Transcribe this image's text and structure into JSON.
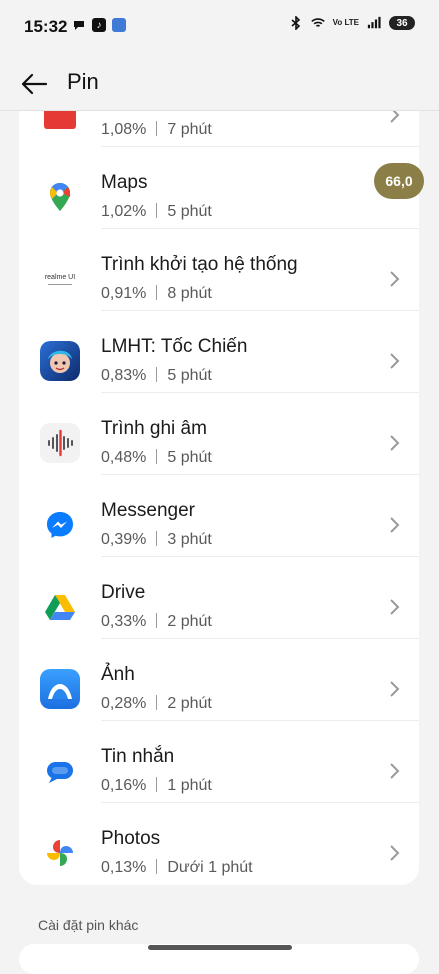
{
  "status_bar": {
    "time": "15:32",
    "network_label": "Vo LTE",
    "battery": "36"
  },
  "header": {
    "title": "Pin"
  },
  "apps": [
    {
      "name": "",
      "percent": "1,08%",
      "time": "7 phút",
      "icon": "red-app-icon"
    },
    {
      "name": "Maps",
      "percent": "1,02%",
      "time": "5 phút",
      "icon": "google-maps-icon"
    },
    {
      "name": "Trình khởi tạo hệ thống",
      "percent": "0,91%",
      "time": "8 phút",
      "icon": "realme-ui-icon",
      "icon_text": "realme UI"
    },
    {
      "name": "LMHT: Tốc Chiến",
      "percent": "0,83%",
      "time": "5 phút",
      "icon": "wild-rift-icon"
    },
    {
      "name": "Trình ghi âm",
      "percent": "0,48%",
      "time": "5 phút",
      "icon": "voice-recorder-icon"
    },
    {
      "name": "Messenger",
      "percent": "0,39%",
      "time": "3 phút",
      "icon": "messenger-icon"
    },
    {
      "name": "Drive",
      "percent": "0,33%",
      "time": "2 phút",
      "icon": "google-drive-icon"
    },
    {
      "name": "Ảnh",
      "percent": "0,28%",
      "time": "2 phút",
      "icon": "photos-gallery-icon"
    },
    {
      "name": "Tin nhắn",
      "percent": "0,16%",
      "time": "1 phút",
      "icon": "messages-icon"
    },
    {
      "name": "Photos",
      "percent": "0,13%",
      "time": "Dưới 1 phút",
      "icon": "google-photos-icon"
    }
  ],
  "overlay_badge": "66,0",
  "section": {
    "other_settings_label": "Cài đặt pin khác"
  },
  "colors": {
    "background": "#f3f3f3",
    "card": "#ffffff",
    "badge": "#8b7e46",
    "messenger_blue": "#0a7cff"
  }
}
